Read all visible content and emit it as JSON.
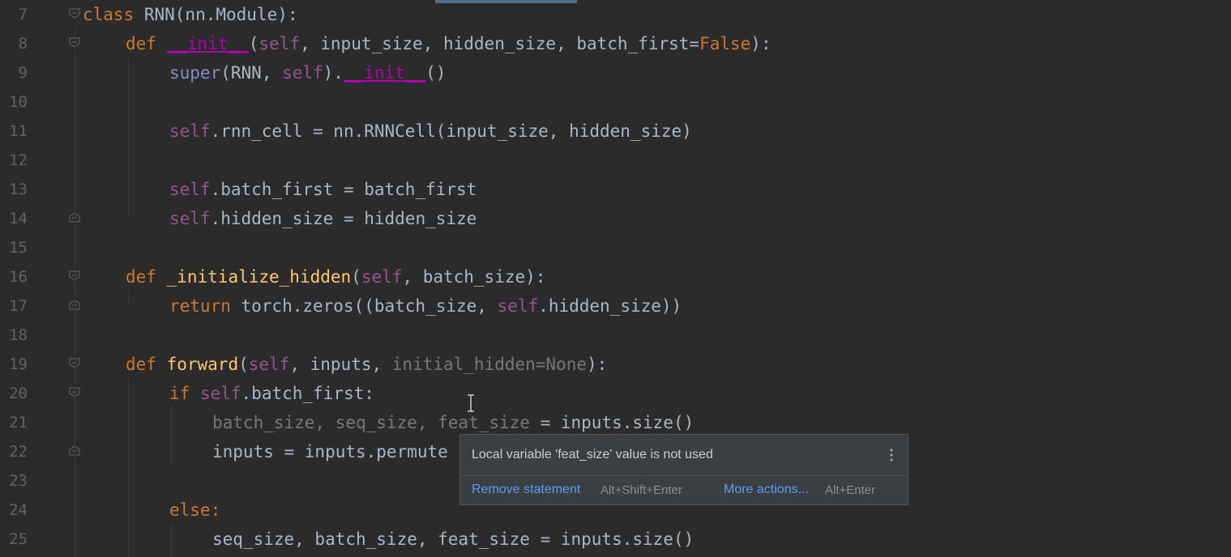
{
  "editor": {
    "line_numbers": [
      "7",
      "8",
      "9",
      "10",
      "11",
      "12",
      "13",
      "14",
      "15",
      "16",
      "17",
      "18",
      "19",
      "20",
      "21",
      "22",
      "23",
      "24",
      "25"
    ],
    "code": {
      "l7": {
        "kw": "class",
        "rest": " RNN(nn.Module):"
      },
      "l8": {
        "kw": "def",
        "magic": "__init__",
        "p1": "(",
        "self": "self",
        "p2": ", input_size, hidden_size, batch_first=",
        "false": "False",
        "p3": "):"
      },
      "l9": {
        "builtin": "super",
        "p1": "(RNN, ",
        "self": "self",
        "p2": ").",
        "magic": "__init__",
        "p3": "()"
      },
      "l11": {
        "self": "self",
        "rest": ".rnn_cell = nn.RNNCell(input_size, hidden_size)"
      },
      "l13": {
        "self": "self",
        "rest": ".batch_first = batch_first"
      },
      "l14": {
        "self": "self",
        "rest": ".hidden_size = hidden_size"
      },
      "l16": {
        "kw": "def",
        "fn": "_initialize_hidden",
        "p1": "(",
        "self": "self",
        "p2": ", batch_size):"
      },
      "l17": {
        "kw": "return",
        "p1": " torch.zeros((batch_size, ",
        "self": "self",
        "p2": ".hidden_size))"
      },
      "l19": {
        "kw": "def",
        "fn": "forward",
        "p1": "(",
        "self": "self",
        "p2": ", inputs, ",
        "unused": "initial_hidden=None",
        "p3": "):"
      },
      "l20": {
        "kw": "if",
        "self": "self",
        "rest": ".batch_first:"
      },
      "l21": {
        "unused": "batch_size, seq_size, feat_size",
        "rest": " = inputs.size()"
      },
      "l22": {
        "rest": "inputs = inputs.permute"
      },
      "l24": {
        "kw": "else:"
      },
      "l25": {
        "rest": "seq_size, batch_size, feat_size = inputs.size()"
      }
    }
  },
  "tooltip": {
    "message": "Local variable 'feat_size' value is not used",
    "menu_icon": "more-vertical-icon",
    "action_primary": "Remove statement",
    "action_primary_shortcut": "Alt+Shift+Enter",
    "action_secondary": "More actions...",
    "action_secondary_shortcut": "Alt+Enter"
  },
  "colors": {
    "background": "#2b2b2b",
    "keyword": "#cc7832",
    "self": "#94558d",
    "function": "#ffc66d",
    "magic": "#b200b2",
    "builtin": "#8888c6",
    "unused": "#787878",
    "text": "#a9b7c6",
    "link": "#589df6"
  }
}
